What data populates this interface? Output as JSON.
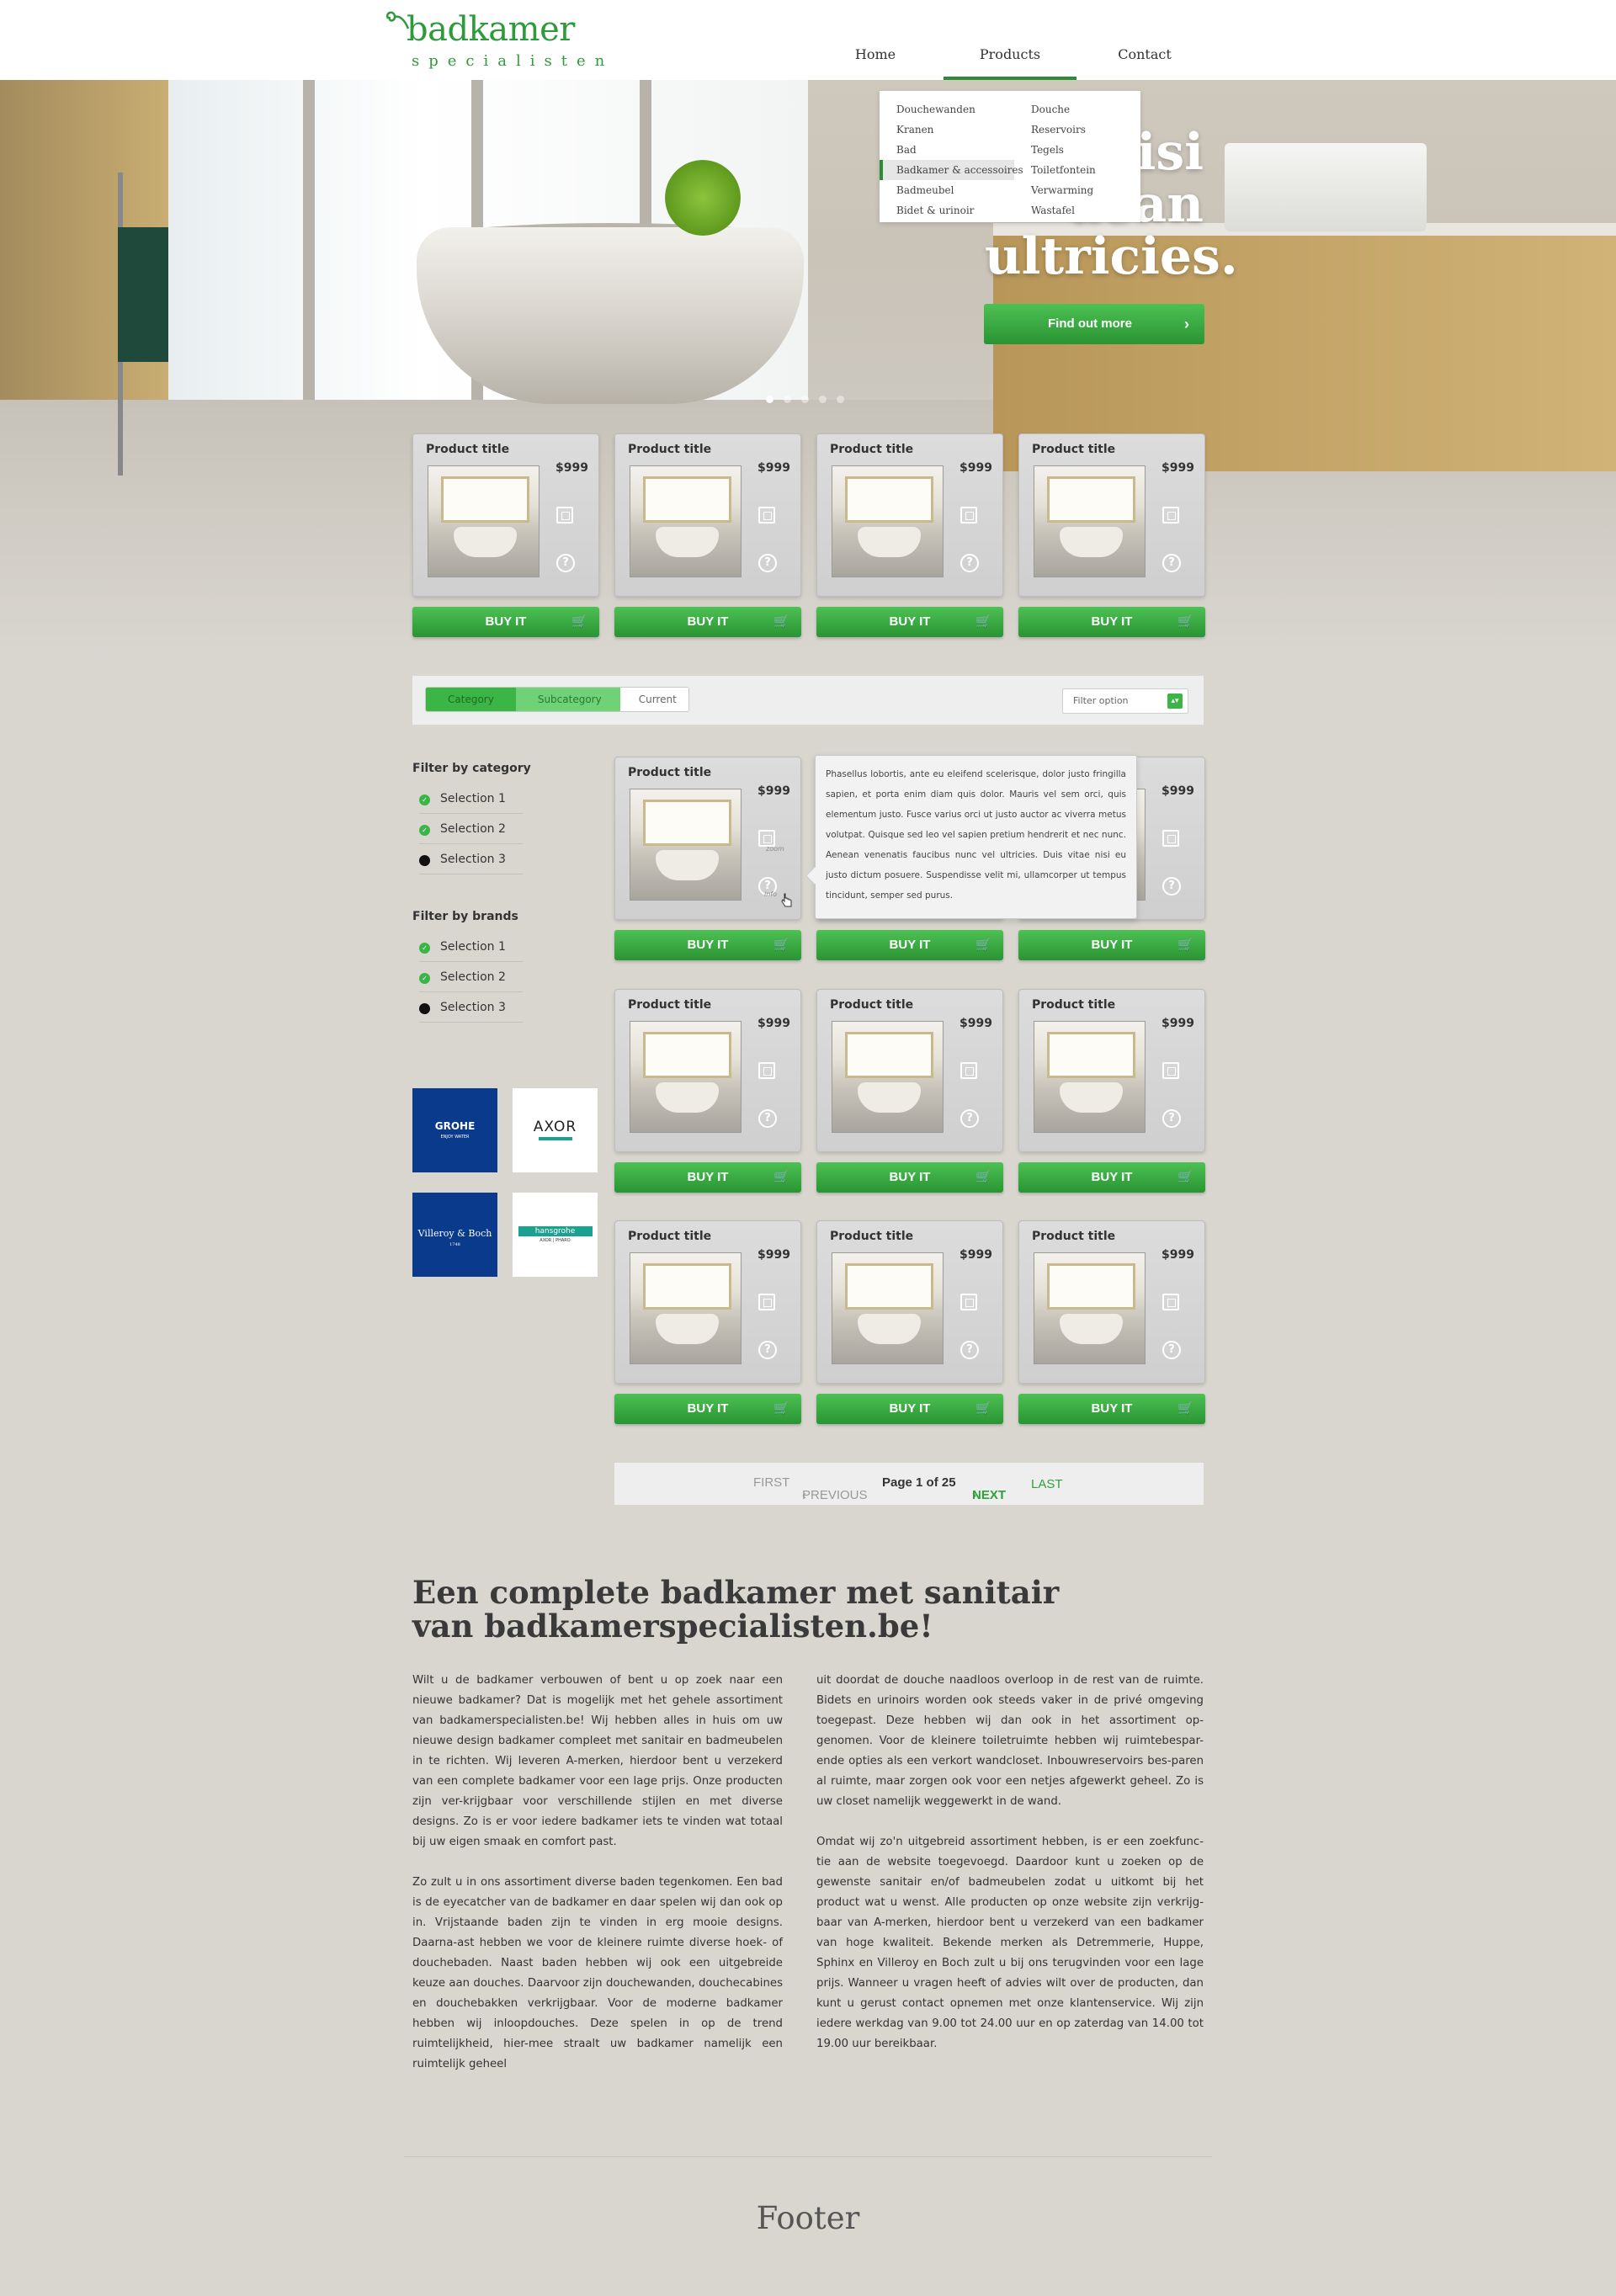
{
  "logo": {
    "brand": "badkamer",
    "tagline": "specialisten"
  },
  "nav": {
    "items": [
      "Home",
      "Products",
      "Contact"
    ],
    "active": "Products"
  },
  "dropdown": {
    "left": [
      "Douchewanden",
      "Kranen",
      "Bad",
      "Badkamer & accessoires",
      "Badmeubel",
      "Bidet & urinoir"
    ],
    "right": [
      "Douche",
      "Reservoirs",
      "Tegels",
      "Toiletfontein",
      "Verwarming",
      "Wastafel"
    ],
    "highlighted": "Badkamer & accessoires"
  },
  "hero": {
    "headline_1": "nisi",
    "headline_2": "aean",
    "headline_3": "ultricies.",
    "cta_label": "Find out more",
    "slide_count": 5,
    "active_slide": 1
  },
  "product": {
    "title": "Product title",
    "price": "$999",
    "buy_label": "BUY IT"
  },
  "breadcrumb": {
    "items": [
      "Category",
      "Subcategory",
      "Current"
    ]
  },
  "filter": {
    "placeholder": "Filter option"
  },
  "sidebar": {
    "category_heading": "Filter by category",
    "category_options": [
      {
        "label": "Selection 1",
        "checked": true
      },
      {
        "label": "Selection 2",
        "checked": true
      },
      {
        "label": "Selection 3",
        "checked": false
      }
    ],
    "brands_heading": "Filter by brands",
    "brand_options": [
      {
        "label": "Selection 1",
        "checked": true
      },
      {
        "label": "Selection 2",
        "checked": true
      },
      {
        "label": "Selection 3",
        "checked": false
      }
    ]
  },
  "brands": {
    "grohe": "GROHE",
    "grohe_sub": "ENJOY WATER",
    "axor": "AXOR",
    "villeroy": "Villeroy & Boch",
    "villeroy_sub": "1748",
    "hansgrohe": "hansgrohe",
    "hansgrohe_sub": "AXOR | PHARO"
  },
  "tooltip": {
    "text": "Phasellus lobortis, ante eu eleifend scelerisque, dolor justo fringilla sapien, et porta enim diam quis dolor. Mauris vel sem orci, quis elementum justo. Fusce varius orci ut justo auctor ac viverra metus volutpat. Quisque sed leo vel sapien pretium hendrerit et nec nunc. Aenean venenatis faucibus nunc vel ultricies. Duis vitae nisi eu justo dictum posuere. Suspendisse velit mi, ullamcorper ut tempus tincidunt, semper sed purus.",
    "zoom_label": "zoom",
    "info_label": "info"
  },
  "pager": {
    "first": "FIRST",
    "previous": "PREVIOUS",
    "current": "Page 1 of 25",
    "next": "NEXT",
    "last": "LAST"
  },
  "seo": {
    "title": "Een complete badkamer met sanitair van badkamerspecialisten.be!",
    "col1": [
      "Wilt u de badkamer verbouwen of bent u op zoek naar een nieuwe badkamer? Dat is mogelijk met het gehele assortiment van badkamerspecialisten.be! Wij hebben alles in huis om uw nieuwe design badkamer compleet met sanitair en badmeubelen in te richten. Wij leveren A-merken, hierdoor bent u verzekerd van een complete badkamer voor een lage prijs. Onze producten zijn ver-krijgbaar voor verschillende stijlen en met diverse designs. Zo is er voor iedere badkamer iets te vinden wat totaal bij uw eigen smaak en comfort past.",
      "Zo zult u in ons assortiment diverse baden tegenkomen. Een bad is de eyecatcher van de badkamer en daar spelen wij dan ook op in. Vrijstaande baden zijn te vinden in erg mooie designs. Daarna-ast hebben we voor de kleinere ruimte diverse hoek- of douchebaden. Naast baden hebben wij ook een uitgebreide keuze aan douches. Daarvoor zijn douchewanden, douchecabines en douchebakken verkrijgbaar. Voor de moderne badkamer hebben wij inloopdouches. Deze spelen in op de trend ruimtelijkheid, hier-mee straalt uw badkamer namelijk een ruimtelijk geheel"
    ],
    "col2": [
      "uit doordat de douche naadloos overloop in de rest van de ruimte. Bidets en urinoirs worden ook steeds vaker in de privé omgeving toegepast. Deze hebben wij dan ook in het assortiment op-genomen. Voor de kleinere toiletruimte hebben wij ruimtebespar-ende opties als een verkort wandcloset. Inbouwreservoirs bes-paren al ruimte, maar zorgen ook voor een netjes afgewerkt geheel. Zo is uw closet namelijk weggewerkt in de wand.",
      "Omdat wij zo'n uitgebreid assortiment hebben, is er een zoekfunc-tie aan de website toegevoegd. Daardoor kunt u zoeken op de gewenste sanitair en/of badmeubelen zodat u uitkomt bij het product wat u wenst. Alle producten op onze website zijn verkrijg-baar van A-merken, hierdoor bent u verzekerd van een badkamer van hoge kwaliteit. Bekende merken als Detremmerie, Huppe, Sphinx en Villeroy en Boch zult u bij ons terugvinden voor een lage prijs. Wanneer u vragen heeft of advies wilt over de producten, dan kunt u gerust contact opnemen met onze klantenservice. Wij zijn iedere werkdag van 9.00 tot 24.00 uur en op zaterdag van 14.00 tot 19.00 uur bereikbaar."
    ]
  },
  "footer": {
    "label": "Footer"
  },
  "colors": {
    "brand_green": "#2f9a3a",
    "button_green": "#3bb546",
    "page_bg": "#d9d6d0"
  },
  "icons": [
    "logo-swirl-icon",
    "zoom-icon",
    "info-icon",
    "cart-icon",
    "chevron-right-icon",
    "chevron-left-icon",
    "check-icon",
    "hand-cursor-icon"
  ]
}
